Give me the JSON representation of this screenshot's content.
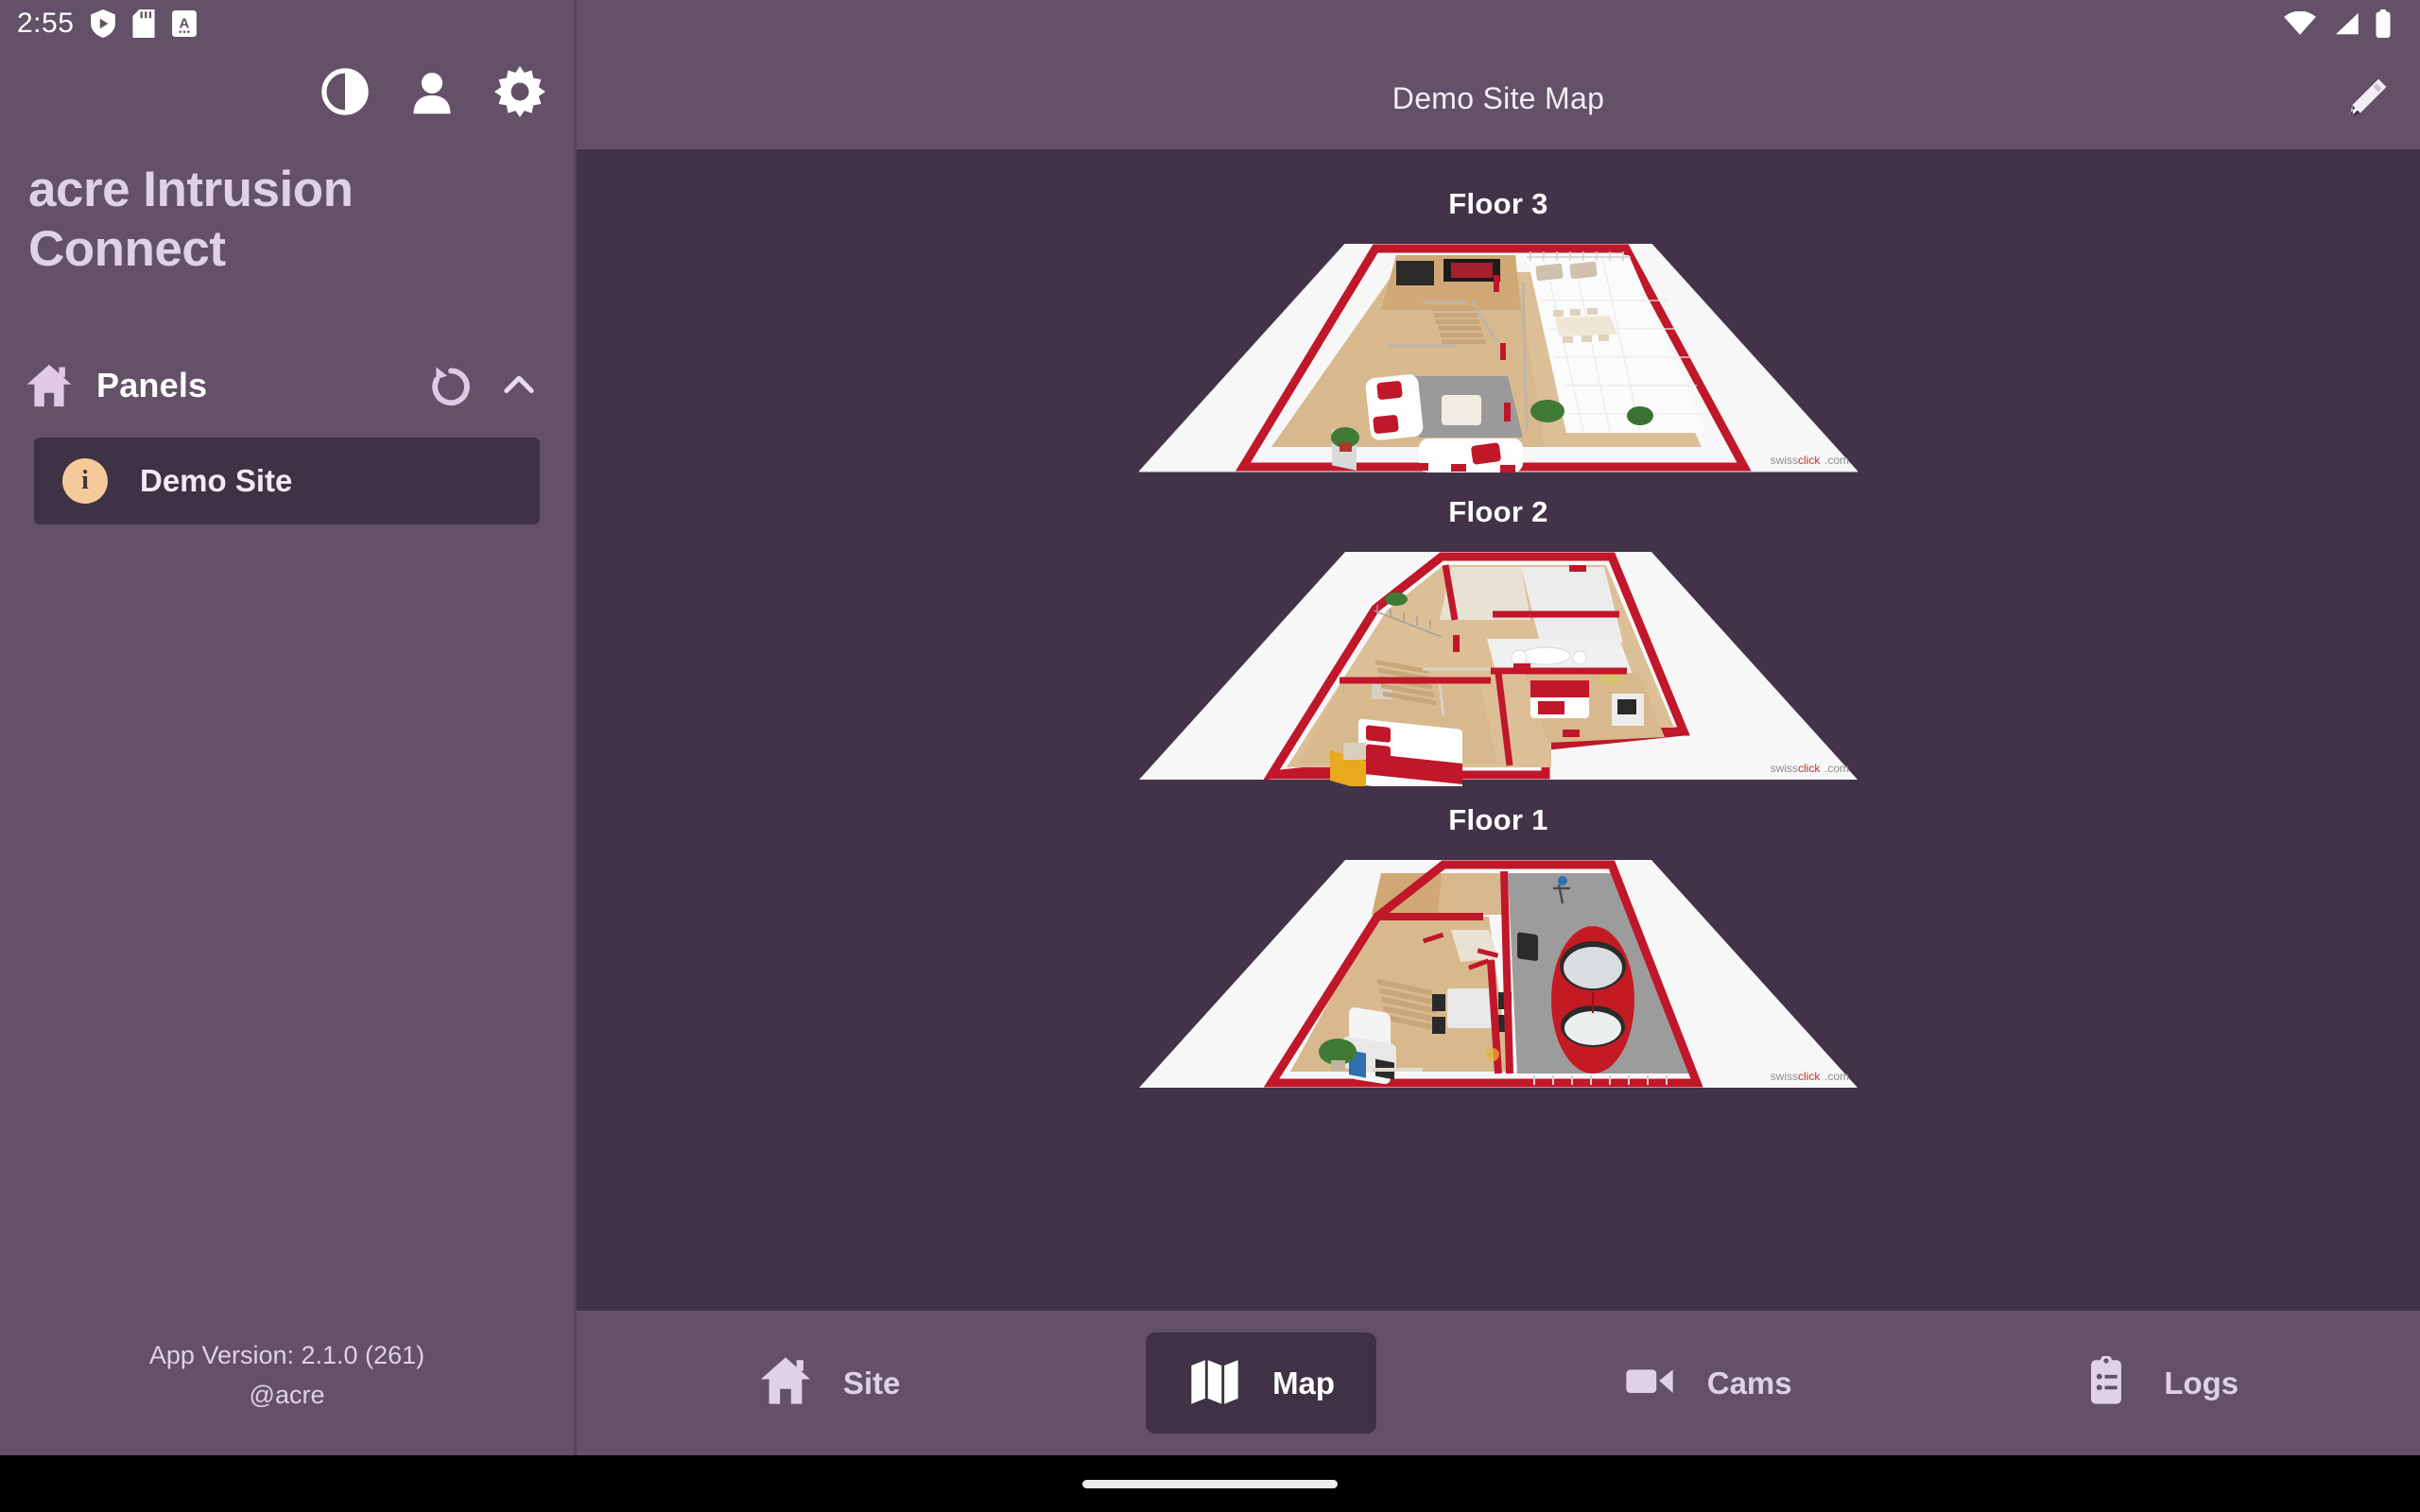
{
  "status_bar": {
    "time": "2:55",
    "left_icons": [
      "play-protect-shield-icon",
      "sd-card-icon",
      "letter-a-notification-icon"
    ],
    "right_icons": [
      "wifi-icon",
      "cellular-signal-icon",
      "battery-icon"
    ]
  },
  "sidebar": {
    "toolbar": [
      {
        "name": "theme-contrast-icon",
        "label": "Theme"
      },
      {
        "name": "account-icon",
        "label": "Account"
      },
      {
        "name": "gear-icon",
        "label": "Settings"
      }
    ],
    "app_title": "acre Intrusion Connect",
    "panels": {
      "label": "Panels",
      "home_icon": "home-icon",
      "refresh_icon": "refresh-icon",
      "collapse_icon": "chevron-up-icon",
      "items": [
        {
          "label": "Demo Site",
          "badge": "i",
          "selected": true
        }
      ]
    },
    "footer": {
      "version": "App Version: 2.1.0 (261)",
      "org": "@acre"
    }
  },
  "header": {
    "title": "Demo Site Map",
    "edit_icon": "pencil-icon"
  },
  "main": {
    "floors": [
      {
        "label": "Floor 3",
        "image": "floor-plan-3-render",
        "watermark": "swissclick.com"
      },
      {
        "label": "Floor 2",
        "image": "floor-plan-2-render",
        "watermark": "swissclick.com"
      },
      {
        "label": "Floor 1",
        "image": "floor-plan-1-render",
        "watermark": "swissclick.com"
      }
    ]
  },
  "bottom_nav": {
    "items": [
      {
        "label": "Site",
        "icon": "home-icon",
        "active": false
      },
      {
        "label": "Map",
        "icon": "map-icon",
        "active": true
      },
      {
        "label": "Cams",
        "icon": "video-camera-icon",
        "active": false
      },
      {
        "label": "Logs",
        "icon": "clipboard-list-icon",
        "active": false
      }
    ]
  },
  "colors": {
    "sidebar_bg": "#635167",
    "content_bg": "#423349",
    "selected_bg": "#3e3244",
    "accent_text": "#ded2e4",
    "badge_bg": "#f6c99a",
    "plan_red": "#c0172a"
  }
}
